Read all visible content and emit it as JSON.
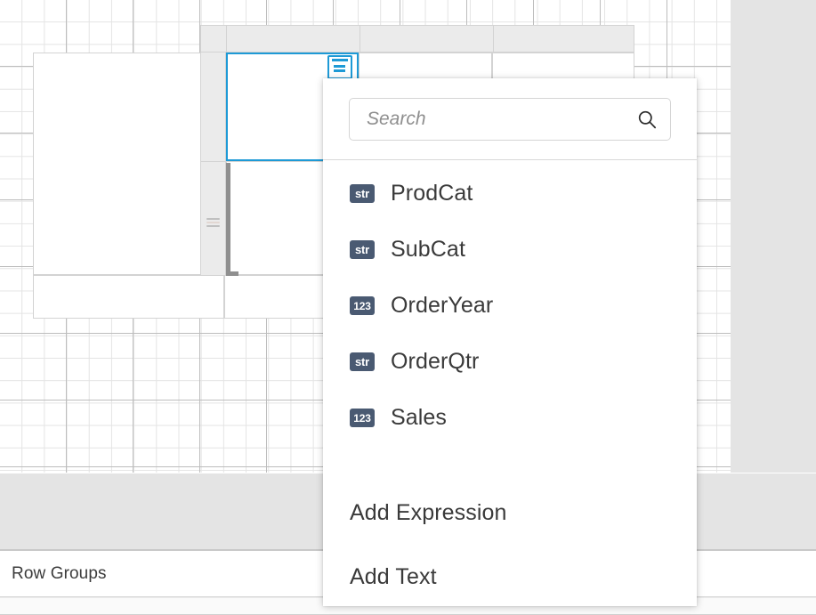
{
  "canvas": {
    "tablix": {
      "selected_cell_present": true,
      "field_selector_icon": "table-field-selector-icon"
    }
  },
  "dropdown": {
    "search": {
      "placeholder": "Search",
      "value": "",
      "icon": "search-icon"
    },
    "fields": [
      {
        "name": "ProdCat",
        "type": "str"
      },
      {
        "name": "SubCat",
        "type": "str"
      },
      {
        "name": "OrderYear",
        "type": "123"
      },
      {
        "name": "OrderQtr",
        "type": "str"
      },
      {
        "name": "Sales",
        "type": "123"
      }
    ],
    "actions": [
      {
        "label": "Add Expression"
      },
      {
        "label": "Add Text"
      }
    ]
  },
  "panels": {
    "row_groups_title": "Row Groups"
  },
  "colors": {
    "accent": "#1e9ad6",
    "badge": "#4a5a72",
    "text": "#3a3a3a",
    "surface": "#ffffff",
    "chrome": "#e4e4e4"
  }
}
